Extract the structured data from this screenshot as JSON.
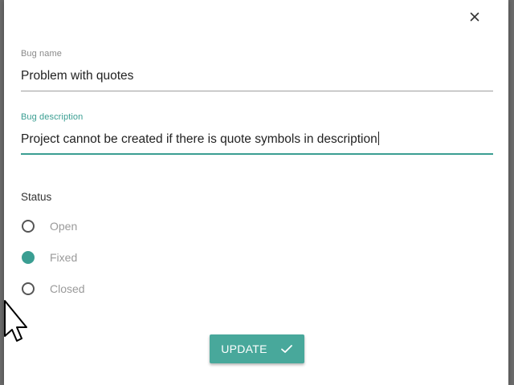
{
  "dialog": {
    "close_glyph": "×",
    "bug_name": {
      "label": "Bug name",
      "value": "Problem with quotes"
    },
    "bug_description": {
      "label": "Bug description",
      "value": "Project cannot be created if there is quote symbols in description"
    },
    "status": {
      "heading": "Status",
      "options": [
        {
          "label": "Open",
          "checked": false
        },
        {
          "label": "Fixed",
          "checked": true
        },
        {
          "label": "Closed",
          "checked": false
        }
      ]
    },
    "update_button": {
      "label": "UPDATE",
      "icon": "check-icon"
    }
  },
  "colors": {
    "accent": "#3a9e92",
    "button": "#48a89b",
    "overlay": "#6b6b6b"
  }
}
